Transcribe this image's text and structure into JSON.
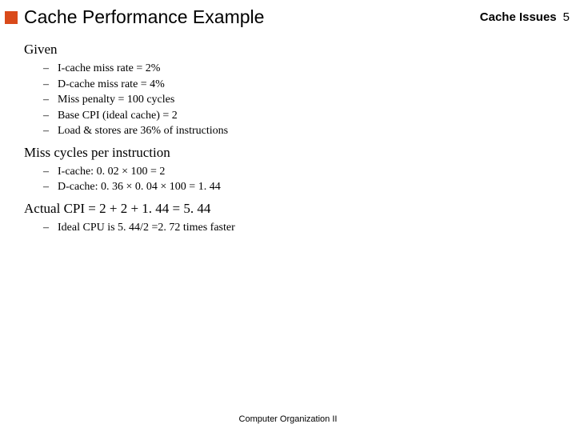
{
  "header": {
    "title": "Cache Performance Example",
    "topic": "Cache Issues",
    "page": "5"
  },
  "sections": {
    "given": {
      "heading": "Given",
      "items": [
        "I-cache miss rate = 2%",
        "D-cache miss rate = 4%",
        "Miss penalty = 100 cycles",
        "Base CPI (ideal cache) = 2",
        "Load & stores are 36% of instructions"
      ]
    },
    "miss": {
      "heading": "Miss cycles per instruction",
      "items": [
        "I-cache: 0. 02 × 100 = 2",
        "D-cache: 0. 36 × 0. 04 × 100 = 1. 44"
      ]
    },
    "actual": {
      "heading": "Actual CPI = 2 + 2 + 1. 44 = 5. 44",
      "items": [
        "Ideal CPU is 5. 44/2 =2. 72 times faster"
      ]
    }
  },
  "footer": "Computer Organization II"
}
